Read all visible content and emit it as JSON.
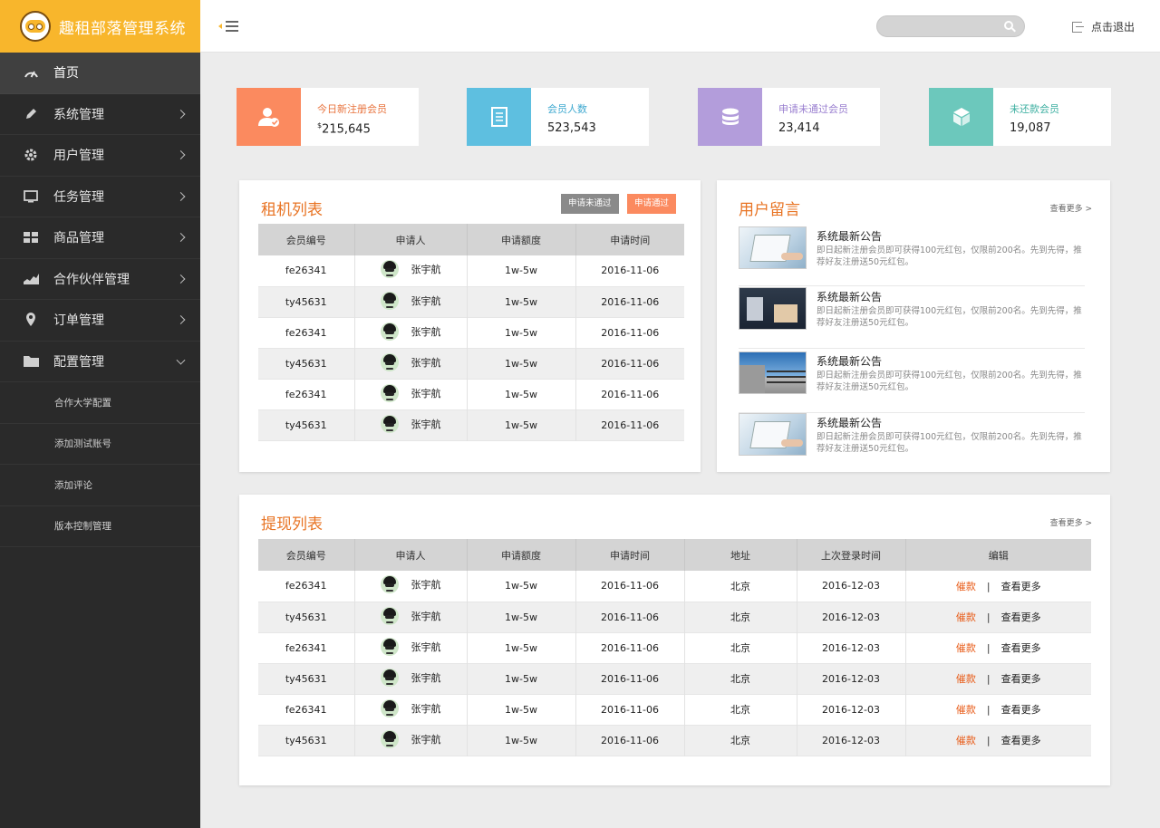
{
  "brand": {
    "title": "趣租部落管理系统"
  },
  "topbar": {
    "search_placeholder": "",
    "logout_label": "点击退出"
  },
  "sidebar": {
    "items": [
      {
        "label": "首页",
        "icon": "dashboard-icon",
        "active": true
      },
      {
        "label": "系统管理",
        "icon": "pencil-icon"
      },
      {
        "label": "用户管理",
        "icon": "gear-icon"
      },
      {
        "label": "任务管理",
        "icon": "monitor-icon"
      },
      {
        "label": "商品管理",
        "icon": "grid-icon"
      },
      {
        "label": "合作伙伴管理",
        "icon": "area-chart-icon"
      },
      {
        "label": "订单管理",
        "icon": "location-pin-icon"
      },
      {
        "label": "配置管理",
        "icon": "folder-icon",
        "expanded": true
      }
    ],
    "subitems": [
      "合作大学配置",
      "添加测试账号",
      "添加评论",
      "版本控制管理"
    ]
  },
  "stats": [
    {
      "label": "今日新注册会员",
      "currency": "$",
      "value": "215,645",
      "color": "#fb8a5f",
      "icon": "user-check-icon"
    },
    {
      "label": "会员人数",
      "value": "523,543",
      "color": "#5ebfe0",
      "icon": "document-icon"
    },
    {
      "label": "申请未通过会员",
      "value": "23,414",
      "color": "#b39ddb",
      "icon": "database-icon"
    },
    {
      "label": "未还款会员",
      "value": "19,087",
      "color": "#6cc8bc",
      "icon": "cube-icon"
    }
  ],
  "rental": {
    "title": "租机列表",
    "btn_rejected": "申请未通过",
    "btn_approved": "申请通过",
    "headers": [
      "会员编号",
      "申请人",
      "申请额度",
      "申请时间"
    ],
    "rows": [
      {
        "id": "fe26341",
        "name": "张宇航",
        "amount": "1w-5w",
        "date": "2016-11-06"
      },
      {
        "id": "ty45631",
        "name": "张宇航",
        "amount": "1w-5w",
        "date": "2016-11-06"
      },
      {
        "id": "fe26341",
        "name": "张宇航",
        "amount": "1w-5w",
        "date": "2016-11-06"
      },
      {
        "id": "ty45631",
        "name": "张宇航",
        "amount": "1w-5w",
        "date": "2016-11-06"
      },
      {
        "id": "fe26341",
        "name": "张宇航",
        "amount": "1w-5w",
        "date": "2016-11-06"
      },
      {
        "id": "ty45631",
        "name": "张宇航",
        "amount": "1w-5w",
        "date": "2016-11-06"
      }
    ]
  },
  "messages": {
    "title": "用户留言",
    "more": "查看更多 >",
    "items": [
      {
        "title": "系统最新公告",
        "body": "即日起新注册会员即可获得100元红包，仅限前200名。先到先得，推荐好友注册送50元红包。"
      },
      {
        "title": "系统最新公告",
        "body": "即日起新注册会员即可获得100元红包，仅限前200名。先到先得，推荐好友注册送50元红包。"
      },
      {
        "title": "系统最新公告",
        "body": "即日起新注册会员即可获得100元红包，仅限前200名。先到先得，推荐好友注册送50元红包。"
      },
      {
        "title": "系统最新公告",
        "body": "即日起新注册会员即可获得100元红包，仅限前200名。先到先得，推荐好友注册送50元红包。"
      }
    ]
  },
  "withdraw": {
    "title": "提现列表",
    "more": "查看更多 >",
    "headers": [
      "会员编号",
      "申请人",
      "申请额度",
      "申请时间",
      "地址",
      "上次登录时间",
      "编辑"
    ],
    "action_urge": "催款",
    "action_sep": "|",
    "action_more": "查看更多",
    "rows": [
      {
        "id": "fe26341",
        "name": "张宇航",
        "amount": "1w-5w",
        "date": "2016-11-06",
        "addr": "北京",
        "last": "2016-12-03"
      },
      {
        "id": "ty45631",
        "name": "张宇航",
        "amount": "1w-5w",
        "date": "2016-11-06",
        "addr": "北京",
        "last": "2016-12-03"
      },
      {
        "id": "fe26341",
        "name": "张宇航",
        "amount": "1w-5w",
        "date": "2016-11-06",
        "addr": "北京",
        "last": "2016-12-03"
      },
      {
        "id": "ty45631",
        "name": "张宇航",
        "amount": "1w-5w",
        "date": "2016-11-06",
        "addr": "北京",
        "last": "2016-12-03"
      },
      {
        "id": "fe26341",
        "name": "张宇航",
        "amount": "1w-5w",
        "date": "2016-11-06",
        "addr": "北京",
        "last": "2016-12-03"
      },
      {
        "id": "ty45631",
        "name": "张宇航",
        "amount": "1w-5w",
        "date": "2016-11-06",
        "addr": "北京",
        "last": "2016-12-03"
      }
    ]
  },
  "colors": {
    "brand": "#f8b62c",
    "accent": "#e87424",
    "sidebar": "#2a2a2a",
    "btn_gray": "#8a8a8a",
    "btn_orange": "#fb8a5f"
  }
}
